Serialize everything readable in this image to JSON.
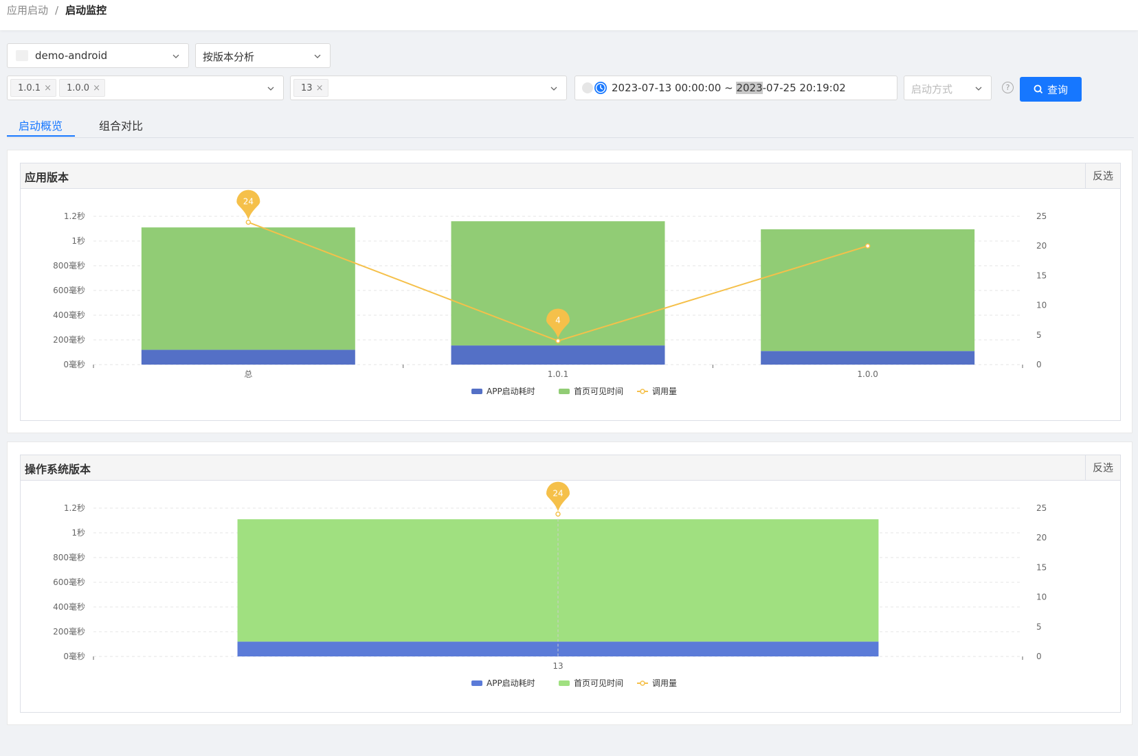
{
  "breadcrumb": {
    "parent": "应用启动",
    "separator": "/",
    "current": "启动监控"
  },
  "filters": {
    "app": "demo-android",
    "analysis_mode": "按版本分析",
    "app_version_tags": [
      "1.0.1",
      "1.0.0"
    ],
    "os_version_tags": [
      "13"
    ],
    "date_start": "2023-07-13 00:00:00",
    "date_separator": "~",
    "date_end_year": "2023",
    "date_end_rest": "-07-25 20:19:02",
    "launch_mode_placeholder": "启动方式",
    "help_glyph": "?",
    "query_label": "查询"
  },
  "tabs": [
    "启动概览",
    "组合对比"
  ],
  "active_tab": 0,
  "colors": {
    "app_launch": "#5470c6",
    "first_screen": "#91cc75",
    "first_screen_os": "#a0e080",
    "calls": "#f5c04a",
    "primary": "#1677ff"
  },
  "cards": [
    {
      "title": "应用版本",
      "invert_label": "反选"
    },
    {
      "title": "操作系统版本",
      "invert_label": "反选"
    }
  ],
  "chart_data": [
    {
      "type": "bar",
      "stacked": true,
      "categories": [
        "总",
        "1.0.1",
        "1.0.0"
      ],
      "series": [
        {
          "name": "APP启动耗时",
          "values": [
            120,
            155,
            110
          ],
          "axis": "left"
        },
        {
          "name": "首页可见时间",
          "values": [
            990,
            1005,
            985
          ],
          "axis": "left"
        },
        {
          "name": "调用量",
          "type": "line",
          "values": [
            24,
            4,
            20
          ],
          "axis": "right"
        }
      ],
      "left_ticks": [
        "0毫秒",
        "200毫秒",
        "400毫秒",
        "600毫秒",
        "800毫秒",
        "1秒",
        "1.2秒"
      ],
      "left_range": [
        0,
        1200
      ],
      "right_ticks": [
        "0",
        "5",
        "10",
        "15",
        "20",
        "25"
      ],
      "right_range": [
        0,
        25
      ],
      "markers": [
        {
          "category": "总",
          "label": "24"
        },
        {
          "category": "1.0.1",
          "label": "4"
        }
      ],
      "grid": true,
      "legend_position": "bottom"
    },
    {
      "type": "bar",
      "stacked": true,
      "categories": [
        "13"
      ],
      "series": [
        {
          "name": "APP启动耗时",
          "values": [
            120
          ],
          "axis": "left"
        },
        {
          "name": "首页可见时间",
          "values": [
            990
          ],
          "axis": "left"
        },
        {
          "name": "调用量",
          "type": "line",
          "values": [
            24
          ],
          "axis": "right"
        }
      ],
      "left_ticks": [
        "0毫秒",
        "200毫秒",
        "400毫秒",
        "600毫秒",
        "800毫秒",
        "1秒",
        "1.2秒"
      ],
      "left_range": [
        0,
        1200
      ],
      "right_ticks": [
        "0",
        "5",
        "10",
        "15",
        "20",
        "25"
      ],
      "right_range": [
        0,
        25
      ],
      "markers": [
        {
          "category": "13",
          "label": "24"
        }
      ],
      "grid": true,
      "legend_position": "bottom"
    }
  ]
}
